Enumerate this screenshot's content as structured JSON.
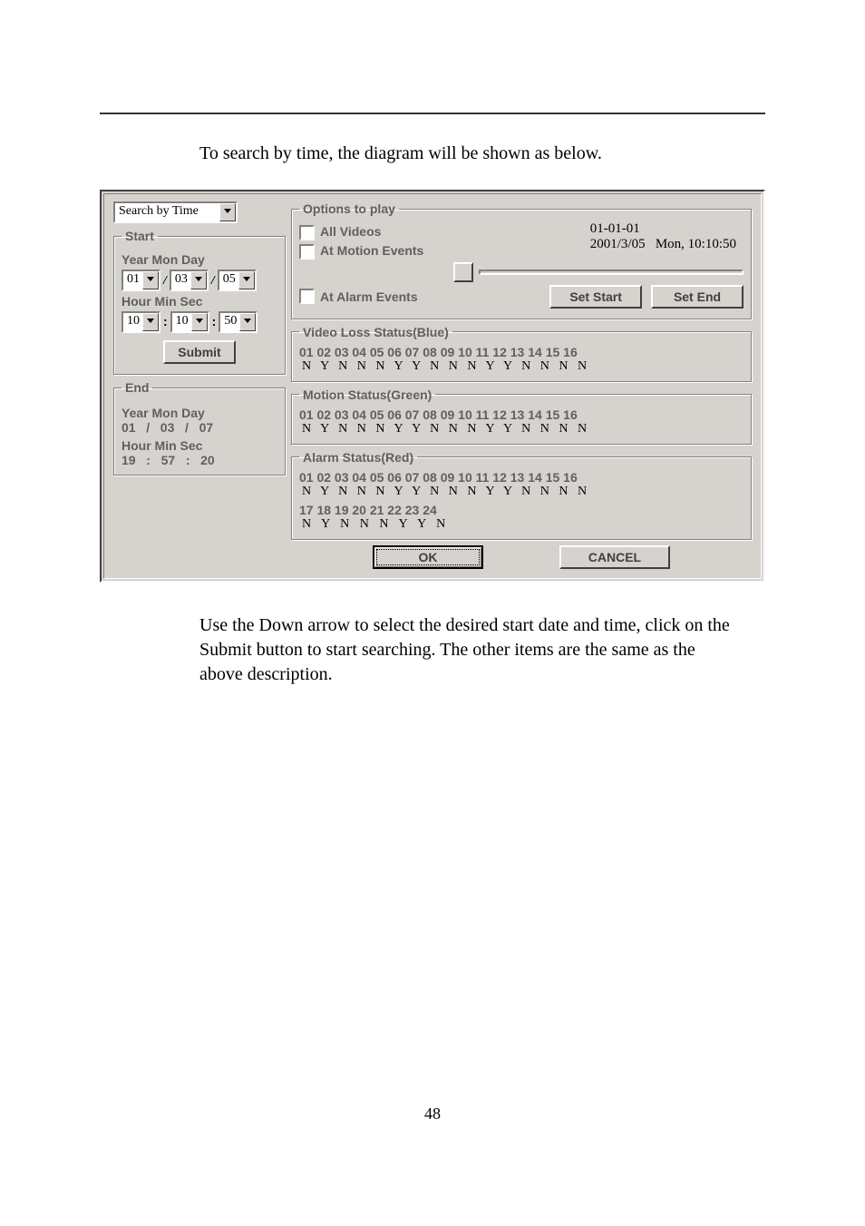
{
  "intro_text": "To search by time, the diagram will be shown as below.",
  "search_mode": "Search by Time",
  "start": {
    "legend": "Start",
    "ymd_label": "Year Mon Day",
    "year": "01",
    "mon": "03",
    "day": "05",
    "hms_label": "Hour Min Sec",
    "hour": "10",
    "min": "10",
    "sec": "50",
    "submit": "Submit"
  },
  "end": {
    "legend": "End",
    "ymd_label": "Year Mon Day",
    "ymd_value": "01   /   03   /   07",
    "hms_label": "Hour Min Sec",
    "hms_value": "19   :   57   :   20"
  },
  "options": {
    "legend": "Options to play",
    "all_videos": "All Videos",
    "at_motion": "At Motion Events",
    "at_alarm": "At Alarm Events",
    "date1": "01-01-01",
    "date2": "2001/3/05   Mon, 10:10:50",
    "set_start": "Set Start",
    "set_end": "Set End"
  },
  "video_loss": {
    "legend": "Video Loss Status(Blue)",
    "nums": "01 02 03 04 05 06 07 08 09 10 11 12 13 14 15 16",
    "vals": "N Y N N N Y Y N N N Y Y N N N N"
  },
  "motion": {
    "legend": "Motion Status(Green)",
    "nums": "01 02 03 04 05 06 07 08 09 10 11 12 13 14 15 16",
    "vals": "N Y N N N Y Y N N N Y Y N N N N"
  },
  "alarm": {
    "legend": "Alarm Status(Red)",
    "nums1": "01 02 03 04 05 06 07 08 09 10 11 12 13 14 15 16",
    "vals1": "N Y N N N Y Y N N N Y Y N N N N",
    "nums2": "17 18 19 20 21 22 23 24",
    "vals2": "N Y N N N Y Y N"
  },
  "ok": "OK",
  "cancel": "CANCEL",
  "desc_text": "Use the Down arrow to select the desired start date and time, click on the Submit button to start searching. The other items are the same as the above description.",
  "page_num": "48"
}
